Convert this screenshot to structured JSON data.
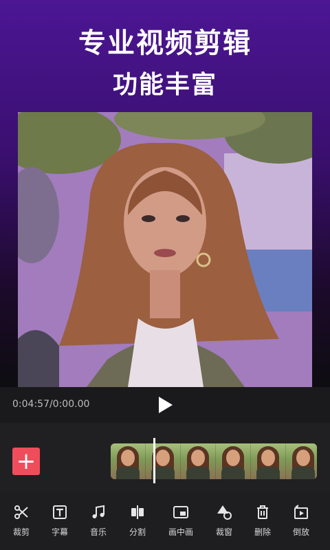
{
  "header": {
    "title_line1": "专业视频剪辑",
    "title_line2": "功能丰富"
  },
  "player": {
    "time": "0:04:57/0:00.00",
    "play_icon": "play-icon"
  },
  "timeline": {
    "add_icon": "plus-icon",
    "add_symbol": "+",
    "thumbnail_count": 6
  },
  "toolbar": {
    "items": [
      {
        "label": "裁剪",
        "icon": "scissors-icon"
      },
      {
        "label": "字幕",
        "icon": "text-icon"
      },
      {
        "label": "音乐",
        "icon": "music-icon"
      },
      {
        "label": "分割",
        "icon": "split-icon"
      },
      {
        "label": "画中画",
        "icon": "picture-in-picture-icon"
      },
      {
        "label": "裁窗",
        "icon": "shapes-icon"
      },
      {
        "label": "删除",
        "icon": "trash-icon"
      },
      {
        "label": "倒放",
        "icon": "reverse-play-icon"
      }
    ]
  },
  "colors": {
    "accent": "#f04d5c",
    "hero_top": "#4c1694",
    "background": "#1e1e20"
  }
}
